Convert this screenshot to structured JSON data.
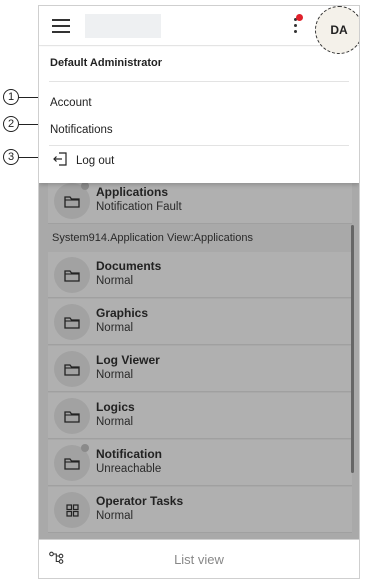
{
  "header": {
    "avatar_initials": "DA",
    "notification_dot_color": "#e0212b"
  },
  "menu": {
    "user_name": "Default Administrator",
    "items": [
      {
        "label": "Account",
        "callout": "1"
      },
      {
        "label": "Notifications",
        "callout": "2"
      }
    ],
    "logout": {
      "label": "Log out",
      "callout": "3"
    }
  },
  "list": {
    "first_row": {
      "title": "Applications",
      "status": "Notification Fault"
    },
    "section_label": "System914.Application View:Applications",
    "rows": [
      {
        "title": "Documents",
        "status": "Normal",
        "icon": "folder-icon"
      },
      {
        "title": "Graphics",
        "status": "Normal",
        "icon": "folder-icon"
      },
      {
        "title": "Log Viewer",
        "status": "Normal",
        "icon": "folder-icon"
      },
      {
        "title": "Logics",
        "status": "Normal",
        "icon": "folder-icon"
      },
      {
        "title": "Notification",
        "status": "Unreachable",
        "icon": "folder-icon"
      },
      {
        "title": "Operator Tasks",
        "status": "Normal",
        "icon": "grid-icon"
      }
    ]
  },
  "bottom": {
    "list_view_label": "List view"
  }
}
